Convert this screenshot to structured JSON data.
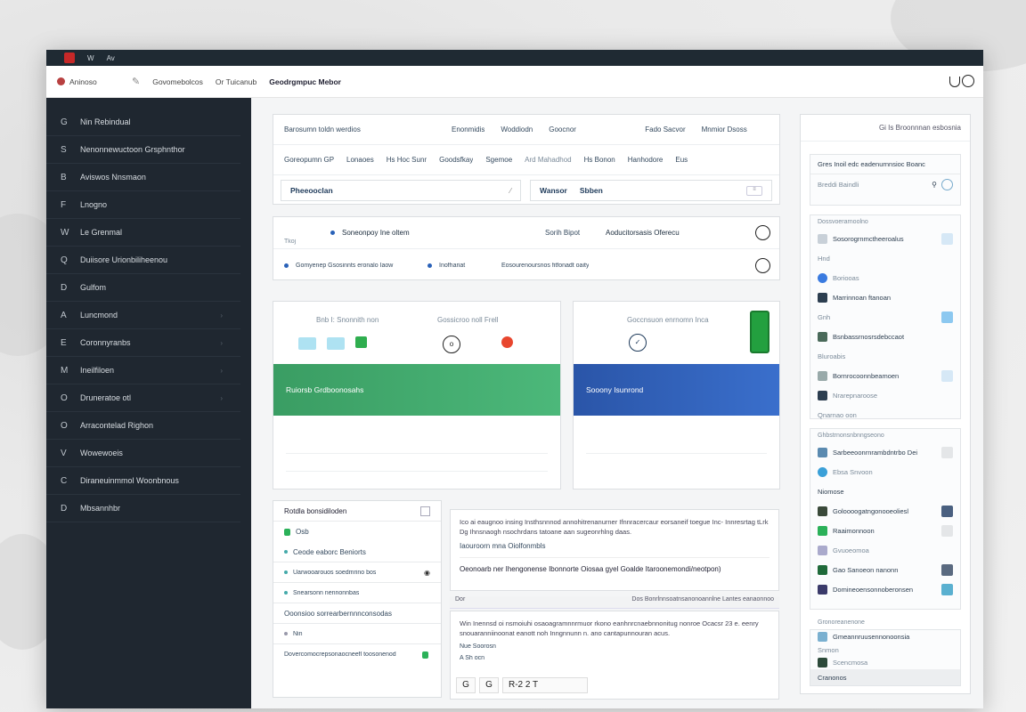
{
  "titlebar": {
    "items": [
      "W",
      "Av"
    ]
  },
  "topbar": {
    "brand": "Aninoso",
    "crumbs": [
      "Govomebolcos",
      "Or Tuicanub"
    ],
    "title": "Geodrgmpuc Mebor"
  },
  "sidebar": {
    "items": [
      {
        "icon": "G",
        "label": "Nin          Rebindual"
      },
      {
        "icon": "S",
        "label": "Nenonnewuctoon Grsphnthor"
      },
      {
        "icon": "B",
        "label": "Aviswos Nnsmaon"
      },
      {
        "icon": "F",
        "label": "Lnogno"
      },
      {
        "icon": "W",
        "label": "Le Grenmal"
      },
      {
        "icon": "Q",
        "label": "Duiisore Urionbiliheenou"
      },
      {
        "icon": "D",
        "label": "Gulfom"
      },
      {
        "icon": "A",
        "label": "Luncmond"
      },
      {
        "icon": "E",
        "label": "Coronnyranbs"
      },
      {
        "icon": "M",
        "label": "Ineilfiloen"
      },
      {
        "icon": "O",
        "label": "Druneratoe otl"
      },
      {
        "icon": "O",
        "label": "Arracontelad Righon"
      },
      {
        "icon": "V",
        "label": "Wowewoeis"
      },
      {
        "icon": "C",
        "label": "Diraneuinmmol Woonbnous"
      },
      {
        "icon": "D",
        "label": "Mbsannhbr"
      }
    ]
  },
  "panel1": {
    "row1": [
      "Barosumn toldn werdios",
      "Enonmidis",
      "Woddiodn",
      "Goocnor",
      "Fado Sacvor",
      "Mnmior Dsoss"
    ],
    "row2": [
      "Goreopumn GP",
      "Lonaoes",
      "Hs Hoc Sunr",
      "Goodsfkay",
      "Sgemoe",
      "Ard Mahadhod",
      "Hs Bonon",
      "Hanhodore",
      "Eus"
    ],
    "field1": "Pheeooclan",
    "field2": "Wansor",
    "field2b": "Sbben"
  },
  "panel2": {
    "tag": "Tkoj",
    "row1a": "Soneonpoy Ine oltem",
    "row1b": "Sorih Bipot",
    "row1c": "Aoducitorsasis Oferecu",
    "row2a": "Gomyenep Gsosinnts eronalo Iaow",
    "row2b": "Inofhariat",
    "row2c": "Eosourenoursnos fitfonadt oaity"
  },
  "tile1": {
    "caption_a": "Bnb I: Snonnith non",
    "caption_b": "Gossicroo noll Frell",
    "band": "Ruiorsb Grdboonosahs"
  },
  "tile2": {
    "caption": "Goccnsuon enrnomn Inca",
    "band": "Sooony Isunrond"
  },
  "list": {
    "title": "Rotdla bonsidiloden",
    "items": [
      "Osb",
      "Ceode eaborc Beniorts",
      "Uarwooarouos soedmrino bos",
      "Snearsonn nennonnbas",
      "Ooonsioo sorrearbernnnconsodas",
      "Nin",
      "Dovercomocrepsonaocneefl toosonenod"
    ]
  },
  "text1": {
    "para": "Ico ai eaugnoo insing Insthsnnnod annohitrenanurner Ifnnracercaur eorsaneif toegue Inc- Innresrtag tLrk Dg Ihnsnaogh nsochrdans tatoane aan sugeonrhlng daas.",
    "line2": "Iaouroorn mna Oiolfonmbls",
    "bold": "Oeonoarb ner Ihengonense Ibonnorte Oiosaa gyel Goalde Itaroonemondi/neotpon)"
  },
  "text2": {
    "head_left": "Dor",
    "head_right": "Dos Bonrlnnsoatnsanonoannlne Lantes eanaonnoo",
    "para": "Win Inennsd oi nsmoiuhi osaoagramnnrmuor rkono eanhnrcnaebnnonitug nonroe Ocacsr 23 e. eenry snouaranniinoonat eanott noh Inngnnunn n. ano cantapunnouran acus.",
    "line1": "Nue Soorosn",
    "line2": "A Sh ocn",
    "tools": [
      "G",
      "G",
      "R-2 2 T"
    ]
  },
  "right": {
    "head": "Gi Is Broonnnan esbosnia",
    "search": "Gres Inoil edc eadenurnnsioc Boanc",
    "search2": "Breddi Baindli",
    "g1_title": "Dossvoerarnoolno",
    "g1": [
      "Sosorogrnmctheeroalus",
      "Hnd",
      "Boriooas",
      "Marrinnoan ftanoan",
      "Gnh",
      "Bsnbassrnosrsdebccaot",
      "Bluroabis",
      "Bornrocoonnbeamoen",
      "Nrarepnaroose",
      "Qnarnao oon"
    ],
    "g2_title": "Ghbstrnonsnbnngseono",
    "g2": [
      "Sarbeeoonrnrambdntrbo Dei",
      "Ebsa Snvoon",
      "Niomose",
      "Goloooogatngonooeoliesl",
      "Raaimonnoon",
      "Gvuoeomoa",
      "Gao Sanoeon nanonn",
      "Domineoensonnoberonsen"
    ],
    "g3_title": "Gronoreanenone",
    "g3": [
      "Gmeannruusennonoonsia",
      "Snmon",
      "Scencmosa",
      "Cranonos"
    ]
  },
  "colors": {
    "sidebar_bg": "#1f2730",
    "green_band": "#3a9d63",
    "blue_band": "#2a55a8",
    "accent_red": "#c62828"
  }
}
